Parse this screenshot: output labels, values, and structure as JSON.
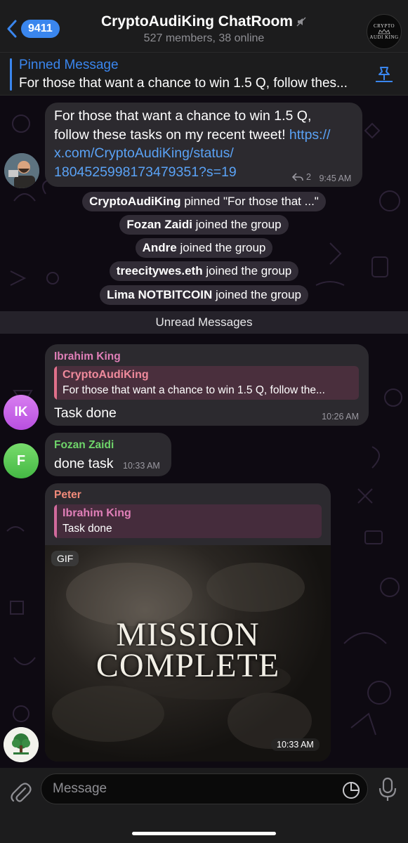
{
  "header": {
    "back_count": "9411",
    "title": "CryptoAudiKing ChatRoom",
    "subtitle": "527 members, 38 online",
    "avatar_line1": "CRYPTO",
    "avatar_line2": "AUDI KING"
  },
  "pinned": {
    "title": "Pinned Message",
    "text": "For those that want a chance to win 1.5 Q, follow thes..."
  },
  "messages": {
    "tweet": {
      "text_line1": "For those that want a chance to win 1.5 Q,",
      "text_line2": "follow these tasks on my recent tweet! ",
      "link_part1": "https://",
      "link_part2": "x.com/CryptoAudiKing/status/",
      "link_part3": "1804525998173479351?s=19",
      "replies": "2",
      "time": "9:45 AM"
    },
    "ibrahim": {
      "name": "Ibrahim King",
      "initials": "IK",
      "quote_name": "CryptoAudiKing",
      "quote_text": "For those that want a chance to win 1.5 Q, follow the...",
      "text": "Task done",
      "time": "10:26 AM"
    },
    "fozan": {
      "name": "Fozan Zaidi",
      "initials": "F",
      "text": "done task",
      "time": "10:33 AM"
    },
    "peter": {
      "name": "Peter",
      "quote_name": "Ibrahim King",
      "quote_text": "Task done",
      "gif_badge": "GIF",
      "gif_line1": "MISSION",
      "gif_line2": "COMPLETE",
      "time": "10:33 AM"
    }
  },
  "service": [
    {
      "bold": "CryptoAudiKing",
      "text": " pinned \"For those that ...\""
    },
    {
      "bold": "Fozan Zaidi",
      "text": " joined the group"
    },
    {
      "bold": "Andre",
      "text": " joined the group"
    },
    {
      "bold": "treecitywes.eth",
      "text": " joined the group"
    },
    {
      "bold": "Lima NOTBITCOIN",
      "text": " joined the group"
    }
  ],
  "unread_label": "Unread Messages",
  "input": {
    "placeholder": "Message"
  },
  "colors": {
    "accent": "#3a86ee",
    "ibrahim_name": "#e07fb8",
    "fozan_name": "#6fd56a",
    "peter_name": "#f08a7a",
    "ibrahim_avatar": "#c85fe6",
    "fozan_avatar": "#4cc24c"
  }
}
